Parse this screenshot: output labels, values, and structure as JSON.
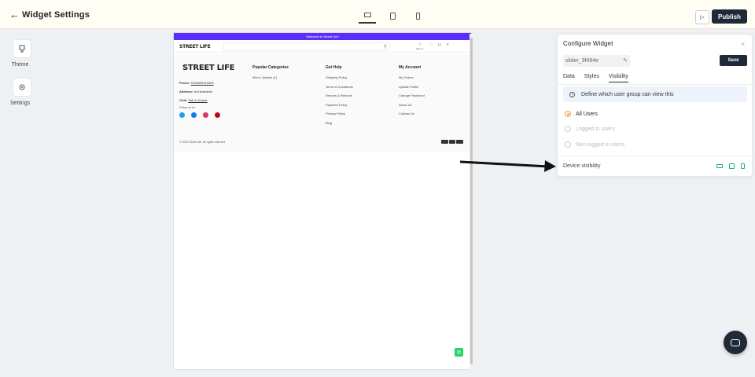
{
  "topbar": {
    "back_glyph": "←",
    "title": "Widget Settings",
    "devices": [
      "desktop-icon",
      "tablet-icon",
      "mobile-icon"
    ],
    "play_glyph": "▷",
    "publish_label": "Publish"
  },
  "sidebar": {
    "items": [
      {
        "label": "Theme",
        "icon": "palette-icon"
      },
      {
        "label": "Settings",
        "icon": "gear-icon"
      }
    ]
  },
  "preview": {
    "announcement": "Welcome to Street Life!",
    "logo": "STREET LIFE",
    "search_glyph": "⚲",
    "sign_in": "Sign In",
    "contact": {
      "phone_label": "Phone:",
      "phone_value": "9198690916490",
      "address_label": "Address:",
      "address_value": "Not Available",
      "chat_label": "Chat:",
      "chat_value": "Talk to Expert",
      "follow": "Follow us on"
    },
    "columns": [
      {
        "title": "Popular Categories",
        "links": [
          "Men's Jackets (1)"
        ]
      },
      {
        "title": "Get Help",
        "links": [
          "Shipping Policy",
          "Terms & Conditions",
          "Returns & Refunds",
          "Payment Policy",
          "Privacy Policy",
          "Blog"
        ]
      },
      {
        "title": "My Account",
        "links": [
          "My Orders",
          "Update Profile",
          "Change Password",
          "About Us",
          "Contact Us"
        ]
      }
    ],
    "copyright": "© 2022 Street Life. All rights reserved"
  },
  "panel": {
    "title": "Configure Widget",
    "close_glyph": "×",
    "widget_id": "slider_3f494e",
    "save_label": "Save",
    "tabs": [
      "Data",
      "Styles",
      "Visibility"
    ],
    "active_tab": "Visibility",
    "info_text": "Define which user group can view this",
    "options": [
      {
        "label": "All Users",
        "selected": true
      },
      {
        "label": "Logged in users",
        "selected": false
      },
      {
        "label": "Non logged in users",
        "selected": false
      }
    ],
    "device_visibility_label": "Device visibility"
  },
  "colors": {
    "accent": "#f0a23a",
    "brand_bar": "#5b2eff",
    "dark_button": "#1f2937",
    "device_icon": "#20b07a"
  }
}
